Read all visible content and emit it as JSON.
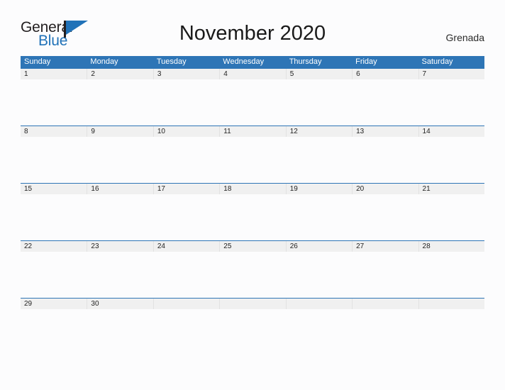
{
  "brand": {
    "name_part1": "General",
    "name_part2": "Blue",
    "mark": "flag-triangle",
    "color_dark": "#231f20",
    "color_blue": "#2072b8"
  },
  "header": {
    "title": "November 2020",
    "month": "November",
    "year": "2020",
    "country": "Grenada"
  },
  "theme": {
    "header_blue": "#2e75b6",
    "date_band_gray": "#f0f0f0",
    "page_background": "#fcfcfd",
    "text_dark": "#1f1f1f"
  },
  "calendar": {
    "weekday_headers": [
      "Sunday",
      "Monday",
      "Tuesday",
      "Wednesday",
      "Thursday",
      "Friday",
      "Saturday"
    ],
    "weeks": [
      {
        "days": [
          {
            "num": "1"
          },
          {
            "num": "2"
          },
          {
            "num": "3"
          },
          {
            "num": "4"
          },
          {
            "num": "5"
          },
          {
            "num": "6"
          },
          {
            "num": "7"
          }
        ]
      },
      {
        "days": [
          {
            "num": "8"
          },
          {
            "num": "9"
          },
          {
            "num": "10"
          },
          {
            "num": "11"
          },
          {
            "num": "12"
          },
          {
            "num": "13"
          },
          {
            "num": "14"
          }
        ]
      },
      {
        "days": [
          {
            "num": "15"
          },
          {
            "num": "16"
          },
          {
            "num": "17"
          },
          {
            "num": "18"
          },
          {
            "num": "19"
          },
          {
            "num": "20"
          },
          {
            "num": "21"
          }
        ]
      },
      {
        "days": [
          {
            "num": "22"
          },
          {
            "num": "23"
          },
          {
            "num": "24"
          },
          {
            "num": "25"
          },
          {
            "num": "26"
          },
          {
            "num": "27"
          },
          {
            "num": "28"
          }
        ]
      },
      {
        "days": [
          {
            "num": "29"
          },
          {
            "num": "30"
          },
          {
            "num": ""
          },
          {
            "num": ""
          },
          {
            "num": ""
          },
          {
            "num": ""
          },
          {
            "num": ""
          }
        ]
      }
    ]
  }
}
